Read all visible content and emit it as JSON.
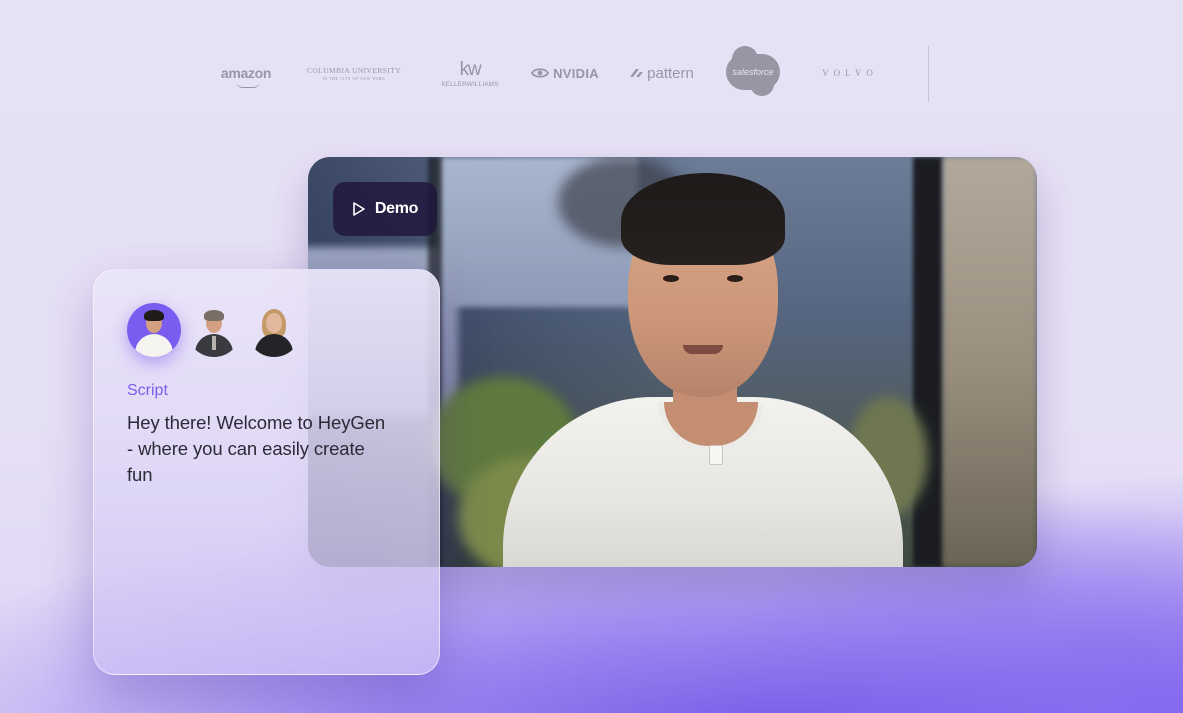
{
  "logos": [
    {
      "name": "amazon",
      "text": "amazon"
    },
    {
      "name": "columbia",
      "line1": "COLUMBIA UNIVERSITY",
      "line2": "IN THE CITY OF NEW YORK"
    },
    {
      "name": "keller-williams",
      "mark": "kw",
      "text": "KELLERWILLIAMS"
    },
    {
      "name": "nvidia",
      "text": "NVIDIA"
    },
    {
      "name": "pattern",
      "text": "pattern"
    },
    {
      "name": "salesforce",
      "text": "salesforce"
    },
    {
      "name": "volvo",
      "text": "VOLVO"
    }
  ],
  "video": {
    "demo_label": "Demo"
  },
  "script_card": {
    "label": "Script",
    "text": "Hey there! Welcome to HeyGen - where you can easily create fun",
    "avatars": [
      {
        "id": "avatar-1",
        "selected": true
      },
      {
        "id": "avatar-2",
        "selected": false
      },
      {
        "id": "avatar-3",
        "selected": false
      }
    ]
  },
  "colors": {
    "accent": "#7a5cf0",
    "background": "#e7e1f5",
    "demo_button_bg": "#1e163c"
  }
}
